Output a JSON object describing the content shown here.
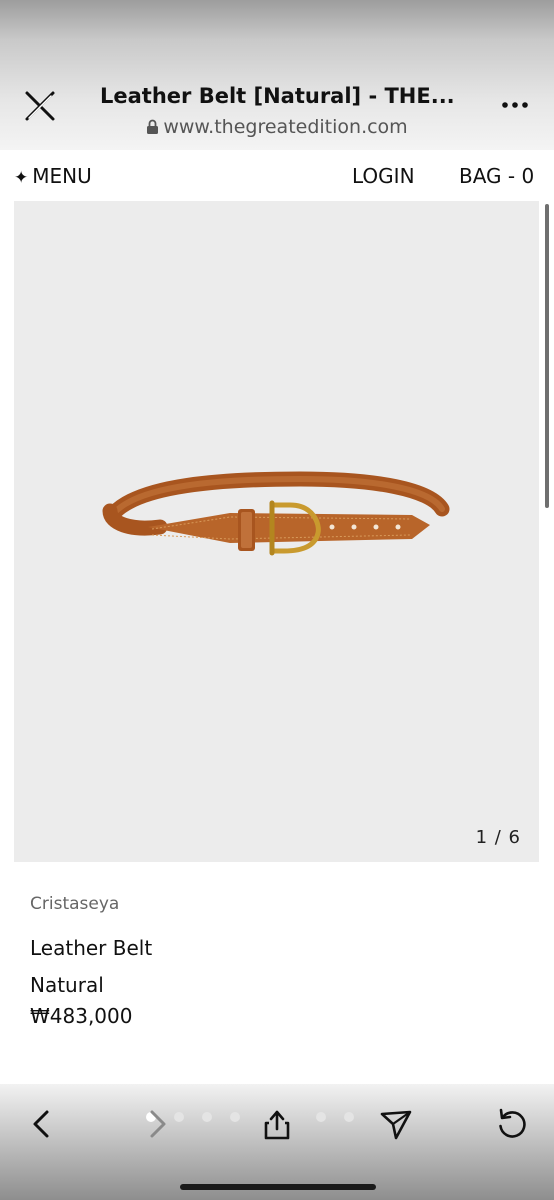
{
  "browser": {
    "title": "Leather Belt [Natural] - THE...",
    "url": "www.thegreatedition.com"
  },
  "site_header": {
    "menu_icon": "✦",
    "menu_label": "MENU",
    "login_label": "LOGIN",
    "bag_label": "BAG - 0"
  },
  "gallery": {
    "counter": "1 / 6",
    "current_image": 1,
    "total_images": 6
  },
  "product": {
    "brand": "Cristaseya",
    "name_line1": "Leather Belt",
    "name_line2": "Natural",
    "price": "₩483,000"
  },
  "colors": {
    "belt_leather": "#b8652a",
    "buckle_gold": "#c99a2e",
    "image_background": "#ececec"
  },
  "toolbar": {
    "icons": [
      "close-icon",
      "lock-icon",
      "more-icon",
      "back-icon",
      "forward-icon",
      "share-icon",
      "send-icon",
      "reload-icon"
    ]
  }
}
